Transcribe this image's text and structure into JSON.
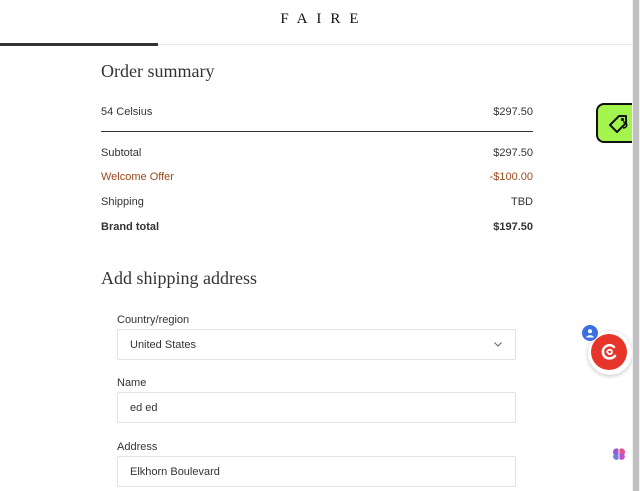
{
  "header": {
    "logo": "FAIRE",
    "progress": 0.25
  },
  "order_summary": {
    "title": "Order summary",
    "item": {
      "name": "54 Celsius",
      "price": "$297.50"
    },
    "subtotal": {
      "label": "Subtotal",
      "value": "$297.50"
    },
    "offer": {
      "label": "Welcome Offer",
      "value": "-$100.00"
    },
    "shipping": {
      "label": "Shipping",
      "value": "TBD"
    },
    "brand_total": {
      "label": "Brand total",
      "value": "$197.50"
    }
  },
  "shipping_address": {
    "title": "Add shipping address",
    "country": {
      "label": "Country/region",
      "value": "United States"
    },
    "name": {
      "label": "Name",
      "value": "ed ed"
    },
    "address": {
      "label": "Address",
      "value": "Elkhorn Boulevard"
    }
  },
  "colors": {
    "offer": "#9a4a1c",
    "tag_button": "#a3f54e",
    "c_widget": "#e8352b",
    "badge": "#3c6fe0"
  },
  "icons": {
    "tag_button": "tag-icon",
    "c_widget": "c-logo-icon",
    "badge": "user-icon",
    "chevron": "chevron-down-icon",
    "brain": "brain-icon"
  }
}
